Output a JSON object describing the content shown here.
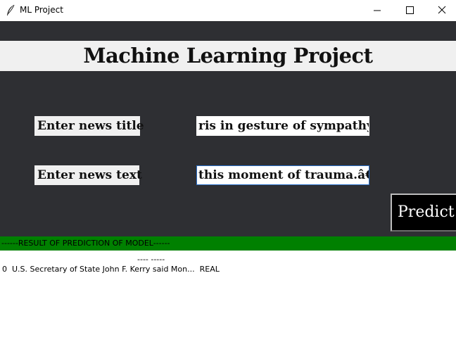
{
  "window": {
    "title": "ML Project",
    "controls": [
      "minimize",
      "maximize",
      "close"
    ]
  },
  "heading": "Machine Learning Project",
  "form": {
    "title_label": "Enter news title",
    "title_value": "ris in gesture of sympathy",
    "text_label": "Enter news text",
    "text_value": "this moment of trauma.â€"
  },
  "predict_label": "Predict",
  "result": {
    "header": "------RESULT OF PREDICTION OF MODEL------",
    "line1": "---- -----",
    "line2": "0  U.S. Secretary of State John F. Kerry said Mon...  REAL"
  },
  "colors": {
    "background": "#2e2f33",
    "result_bar": "#008000",
    "predict_button": "#000000"
  },
  "icons": {
    "app": "feather-icon",
    "minimize": "minimize-icon",
    "maximize": "maximize-icon",
    "close": "close-icon"
  }
}
